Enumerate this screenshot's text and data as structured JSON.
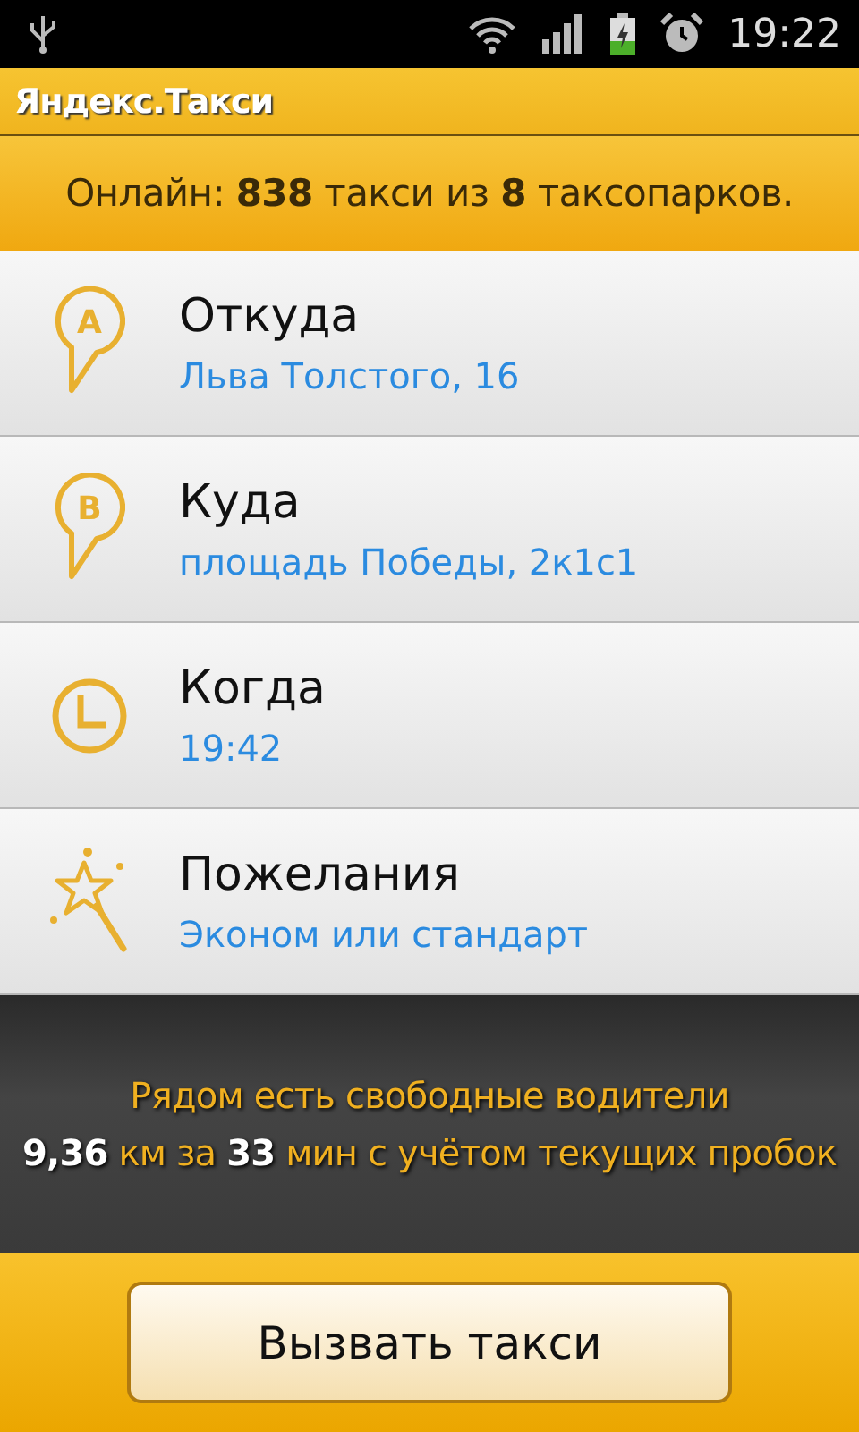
{
  "status_bar": {
    "time": "19:22"
  },
  "app_title": "Яндекс.Такси",
  "online": "Онлайн: **838** такси из **8** таксопарков.",
  "rows": [
    {
      "kind": "pin",
      "marker": "A",
      "title": "Откуда",
      "value": "Льва Толстого, 16"
    },
    {
      "kind": "pin",
      "marker": "B",
      "title": "Куда",
      "value": "площадь Победы, 2к1с1"
    },
    {
      "kind": "clock",
      "title": "Когда",
      "value": "19:42"
    },
    {
      "kind": "wand",
      "title": "Пожелания",
      "value": "Эконом или стандарт"
    }
  ],
  "info": {
    "line_1": "Рядом есть свободные водители",
    "line_2": "**9,36** км за **33** мин с учётом текущих пробок"
  },
  "call_button": "Вызвать такси"
}
